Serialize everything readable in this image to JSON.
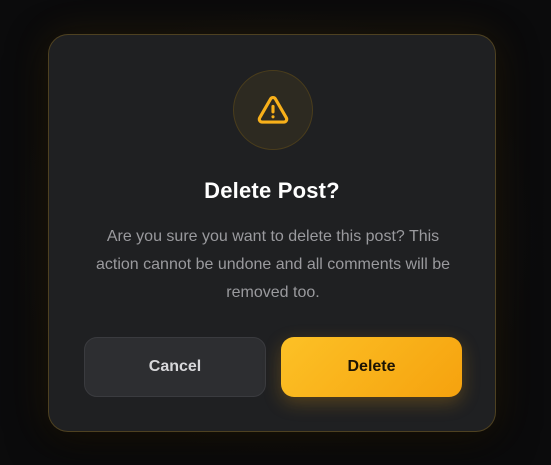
{
  "dialog": {
    "icon": "warning-triangle-icon",
    "title": "Delete Post?",
    "message": "Are you sure you want to delete this post? This action cannot be undone and all comments will be removed too.",
    "cancel_label": "Cancel",
    "delete_label": "Delete"
  },
  "colors": {
    "accent": "#F8B01A",
    "dialog_background": "#1F2022",
    "page_background": "#0B0B0C",
    "cancel_button": "#2D2E31"
  }
}
